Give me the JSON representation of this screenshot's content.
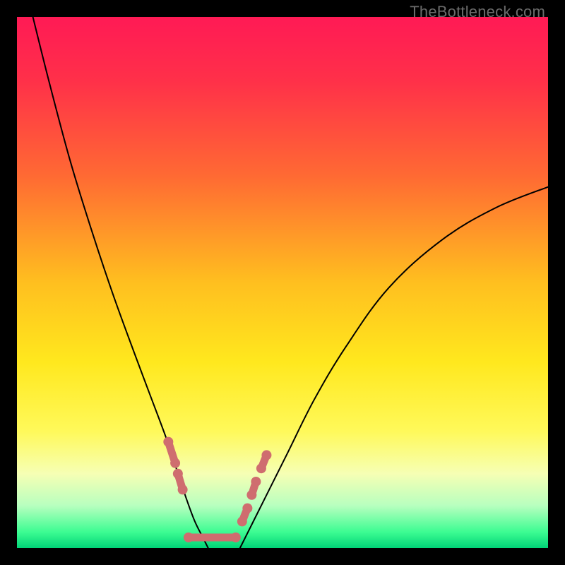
{
  "watermark": "TheBottleneck.com",
  "chart_data": {
    "type": "line",
    "title": "",
    "xlabel": "",
    "ylabel": "",
    "xlim": [
      0,
      100
    ],
    "ylim": [
      0,
      100
    ],
    "grid": false,
    "legend": false,
    "background": {
      "type": "vertical-gradient",
      "stops": [
        {
          "pos": 0.0,
          "color": "#ff1a55"
        },
        {
          "pos": 0.12,
          "color": "#ff3049"
        },
        {
          "pos": 0.3,
          "color": "#ff6a33"
        },
        {
          "pos": 0.5,
          "color": "#ffbf1f"
        },
        {
          "pos": 0.65,
          "color": "#ffe81e"
        },
        {
          "pos": 0.78,
          "color": "#fff95a"
        },
        {
          "pos": 0.86,
          "color": "#f6ffb4"
        },
        {
          "pos": 0.92,
          "color": "#b8ffbf"
        },
        {
          "pos": 0.97,
          "color": "#3cfc92"
        },
        {
          "pos": 1.0,
          "color": "#00d477"
        }
      ]
    },
    "series": [
      {
        "name": "left-curve",
        "stroke": "#000000",
        "stroke_width": 2,
        "x": [
          3,
          6,
          10,
          14,
          18,
          22,
          25,
          28,
          30,
          32,
          33.5,
          35,
          36
        ],
        "y": [
          100,
          88,
          73,
          60,
          48,
          37,
          29,
          21,
          15,
          9,
          5,
          2,
          0
        ]
      },
      {
        "name": "right-curve",
        "stroke": "#000000",
        "stroke_width": 2,
        "x": [
          42,
          44,
          47,
          51,
          56,
          62,
          70,
          80,
          90,
          100
        ],
        "y": [
          0,
          4,
          10,
          18,
          28,
          38,
          49,
          58,
          64,
          68
        ]
      },
      {
        "name": "valley-marker",
        "type": "marker-run",
        "stroke": "#cf6d6f",
        "fill": "#cf6d6f",
        "marker_radius": 7,
        "line_width": 11,
        "segments": [
          {
            "x": [
              28.5,
              29.8
            ],
            "y": [
              20,
              16
            ]
          },
          {
            "x": [
              30.3,
              31.2
            ],
            "y": [
              14,
              11
            ]
          },
          {
            "x": [
              32.3,
              41.2
            ],
            "y": [
              2.0,
              2.0
            ]
          },
          {
            "x": [
              42.4,
              43.4
            ],
            "y": [
              5.0,
              7.5
            ]
          },
          {
            "x": [
              44.2,
              45.0
            ],
            "y": [
              10.0,
              12.5
            ]
          },
          {
            "x": [
              46.0,
              47.0
            ],
            "y": [
              15.0,
              17.5
            ]
          }
        ]
      }
    ]
  }
}
